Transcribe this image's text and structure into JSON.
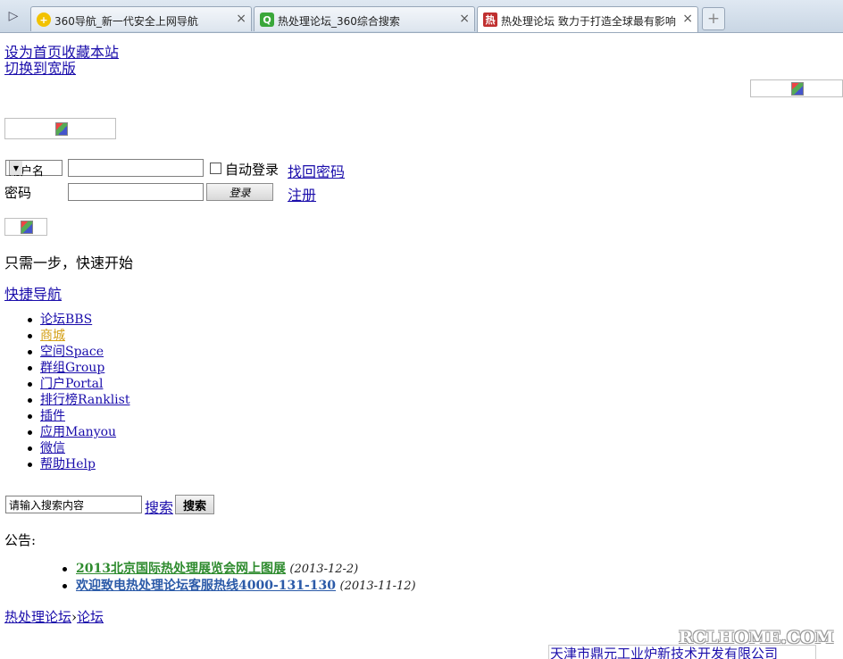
{
  "browser": {
    "tabs": [
      {
        "title": "360导航_新一代安全上网导航",
        "favicon": "360-nav-icon",
        "color": "#2e9e2e"
      },
      {
        "title": "热处理论坛_360综合搜索",
        "favicon": "360-search-icon",
        "color": "#3aa73a"
      },
      {
        "title": "热处理论坛 致力于打造全球最有影响",
        "favicon": "rclhome-site-icon",
        "color": "#c03030"
      }
    ],
    "active_tab": 2,
    "close_glyph": "×",
    "new_tab_glyph": "+"
  },
  "top_links": {
    "set_home": "设为首页",
    "bookmark": "收藏本站",
    "switch_wide": "切换到宽版"
  },
  "login": {
    "select_value": "用户名",
    "auto_login": "自动登录",
    "forgot_password": "找回密码",
    "password_label": "密码",
    "login_button": "登录",
    "register": "注册"
  },
  "quick_start": "只需一步，快速开始",
  "quick_nav": "快捷导航",
  "nav_items": [
    {
      "label": "论坛BBS",
      "color": "#1a0dab"
    },
    {
      "label": "商城",
      "color": "#d4a017"
    },
    {
      "label": "空间Space",
      "color": "#1a0dab"
    },
    {
      "label": "群组Group",
      "color": "#1a0dab"
    },
    {
      "label": "门户Portal",
      "color": "#1a0dab"
    },
    {
      "label": "排行榜Ranklist",
      "color": "#1a0dab"
    },
    {
      "label": "插件",
      "color": "#1a0dab"
    },
    {
      "label": "应用Manyou",
      "color": "#1a0dab"
    },
    {
      "label": "微信",
      "color": "#1a0dab"
    },
    {
      "label": "帮助Help",
      "color": "#1a0dab"
    }
  ],
  "search": {
    "input_value": "请输入搜索内容",
    "link": "搜索",
    "button": "搜索"
  },
  "notice_label": "公告:",
  "notices": [
    {
      "title": "2013北京国际热处理展览会网上图展",
      "date": "(2013-12-2)",
      "color": "#2e8b2e"
    },
    {
      "title": "欢迎致电热处理论坛客服热线4000-131-130",
      "date": "(2013-11-12)",
      "color": "#2b5aa8"
    }
  ],
  "breadcrumb": {
    "home": "热处理论坛",
    "sep": "›",
    "current": "论坛"
  },
  "footer_company": "天津市鼎元工业炉新技术开发有限公司",
  "watermark": "RCLHOME.COM"
}
